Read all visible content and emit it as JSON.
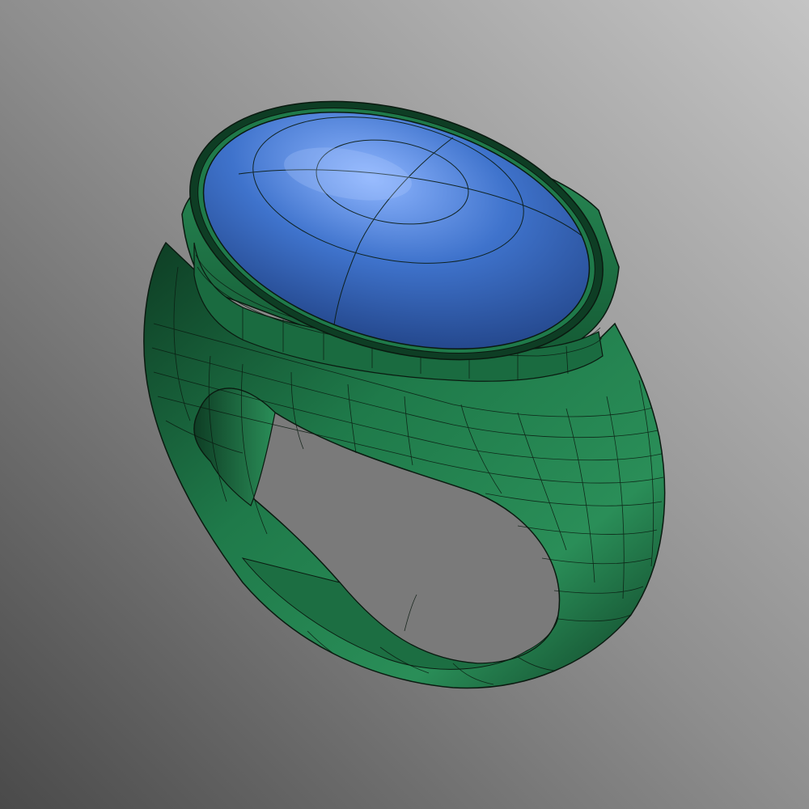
{
  "scene": {
    "background": {
      "light": "#c4c4c4",
      "mid": "#8e8e8e",
      "dark": "#4a4a4a"
    },
    "model": {
      "subject": "ring",
      "display_mode": "wireframe-on-shaded",
      "parts": [
        {
          "name": "shank",
          "color": "#1f7a4a",
          "shadow": "#0e3d24",
          "highlight": "#3aa06a"
        },
        {
          "name": "bezel",
          "color": "#1f7a4a",
          "shadow": "#0e3d24",
          "highlight": "#3aa06a"
        },
        {
          "name": "cabochon-stone",
          "color": "#3f73cc",
          "shadow": "#1f3f80",
          "highlight": "#8fb6ff"
        }
      ],
      "wire_color": "#0a1a10"
    }
  }
}
